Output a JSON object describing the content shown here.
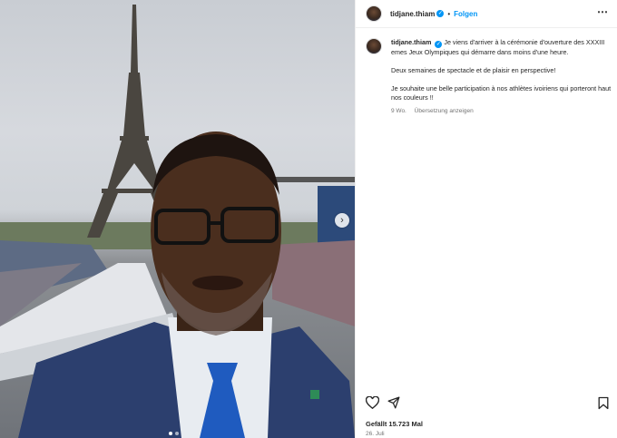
{
  "post": {
    "username": "tidjane.thiam",
    "separator": "•",
    "follow_label": "Folgen",
    "more_label": "⋯",
    "caption_lines": [
      "Je viens d'arriver à la cérémonie d'ouverture des XXXIII emes Jeux Olympiques qui démarre dans moins d'une heure.",
      "Deux semaines de spectacle et de plaisir en perspective!",
      "Je souhaite une belle participation à nos athlètes ivoiriens qui porteront haut nos couleurs !!"
    ],
    "age": "9 Wo.",
    "translate_label": "Übersetzung anzeigen",
    "likes_text": "Gefällt 15.723 Mal",
    "date": "26. Juli",
    "next_label": "›"
  },
  "icons": [
    "heart-icon",
    "share-icon",
    "bookmark-icon",
    "verified-icon",
    "more-icon"
  ],
  "colors": {
    "link": "#0095f6",
    "text": "#262626",
    "muted": "#737373"
  }
}
